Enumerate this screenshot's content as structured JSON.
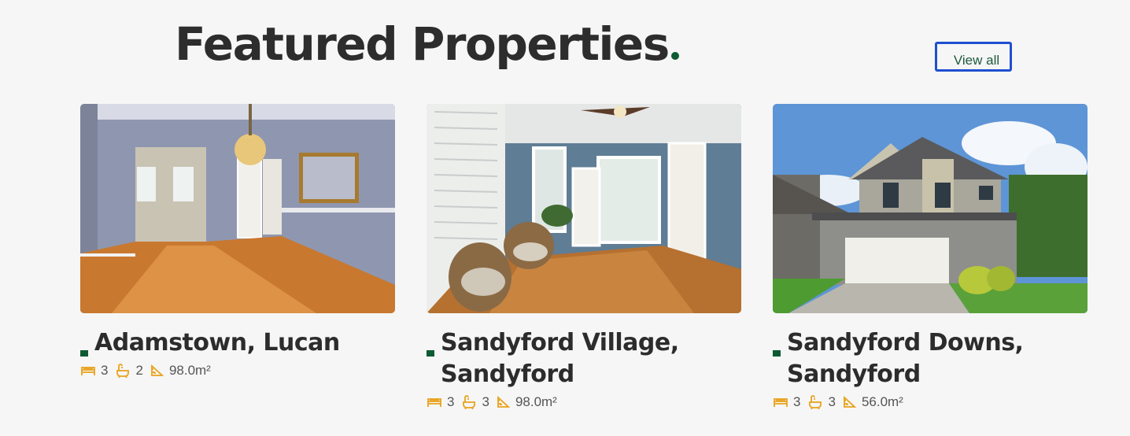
{
  "section": {
    "title": "Featured Properties",
    "view_all_label": "View all"
  },
  "colors": {
    "accent_green": "#0e5a32",
    "icon_amber": "#e8a21b",
    "focus_blue": "#1f4fd0"
  },
  "properties": [
    {
      "title": "Adamstown, Lucan",
      "beds": "3",
      "baths": "2",
      "area": "98.0m²",
      "image": "empty-dining-room-photo"
    },
    {
      "title": "Sandyford Village, Sandyford",
      "beds": "3",
      "baths": "3",
      "area": "98.0m²",
      "image": "sunroom-with-wicker-chairs-photo"
    },
    {
      "title": "Sandyford Downs, Sandyford",
      "beds": "3",
      "baths": "3",
      "area": "56.0m²",
      "image": "two-storey-house-exterior-photo"
    }
  ],
  "icons": {
    "beds": "bed-icon",
    "baths": "bath-icon",
    "area": "area-ruler-icon"
  }
}
